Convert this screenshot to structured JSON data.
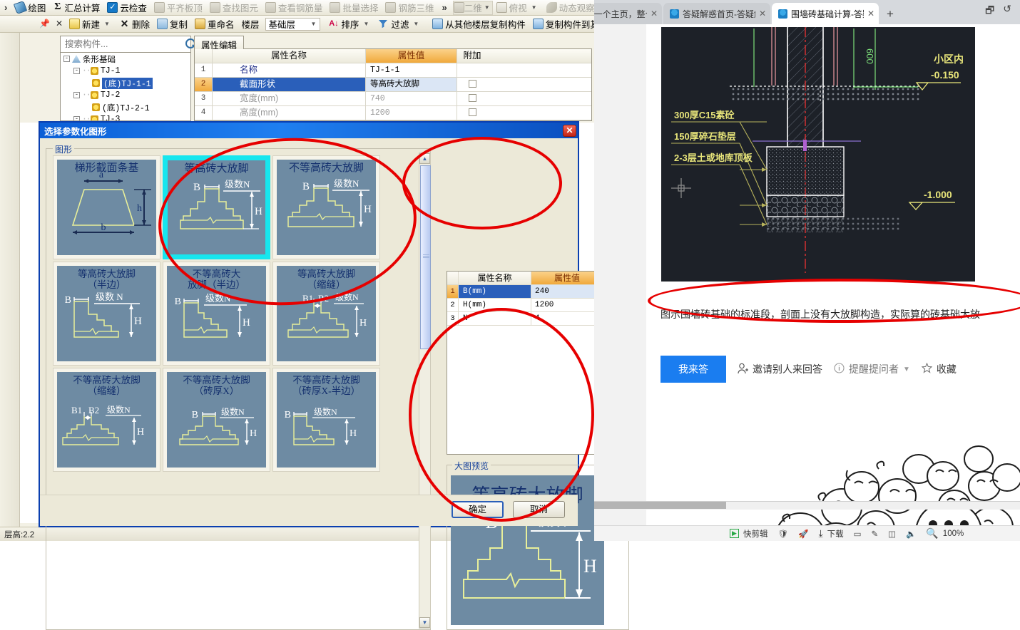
{
  "app": {
    "toolbar1": [
      {
        "label": "绘图",
        "icon": "pen-icon",
        "dim": false
      },
      {
        "label": "汇总计算",
        "icon": "sigma-icon",
        "dim": false
      },
      {
        "label": "云检查",
        "icon": "cloud-check-icon",
        "dim": false
      },
      {
        "label": "平齐板顶",
        "icon": "align-slab-icon",
        "dim": true
      },
      {
        "label": "查找图元",
        "icon": "binoculars-icon",
        "dim": true
      },
      {
        "label": "查看钢筋量",
        "icon": "rebar-view-icon",
        "dim": true
      },
      {
        "label": "批量选择",
        "icon": "batch-select-icon",
        "dim": true
      },
      {
        "label": "钢筋三维",
        "icon": "rebar-3d-icon",
        "dim": true
      }
    ],
    "toolbar1_overflow": "»",
    "toolbar1_right": [
      {
        "label": "二维",
        "icon": "2d-icon",
        "caret": true
      },
      {
        "label": "俯视",
        "icon": "topview-icon",
        "caret": true
      },
      {
        "label": "动态观察",
        "icon": "orbit-icon",
        "caret": false
      }
    ],
    "toolbar1_right_overflow": "»",
    "toolbar2": [
      {
        "label": "新建",
        "icon": "new-icon",
        "caret": true
      },
      {
        "label": "删除",
        "icon": "delete-icon",
        "caret": false
      },
      {
        "label": "复制",
        "icon": "copy-icon",
        "caret": false
      },
      {
        "label": "重命名",
        "icon": "rename-icon",
        "caret": false
      }
    ],
    "floor_label": "楼层",
    "floor_value": "基础层",
    "toolbar2b": [
      {
        "label": "排序",
        "icon": "sort-icon",
        "caret": true
      },
      {
        "label": "过滤",
        "icon": "filter-icon",
        "caret": true
      },
      {
        "label": "从其他楼层复制构件",
        "icon": "copy-from-floor-icon",
        "caret": false
      },
      {
        "label": "复制构件到其他楼层",
        "icon": "copy-to-floor-icon",
        "caret": false
      }
    ],
    "toolbar2_overflow": "»",
    "pin_icon": "pin-icon",
    "close_icon": "close-icon",
    "tree": {
      "search_placeholder": "搜索构件...",
      "search_value": "",
      "search_icon": "search-icon",
      "nodes": [
        {
          "depth": 0,
          "expander": "-",
          "icon": "strip-foundation-icon",
          "label": "条形基础",
          "selected": false
        },
        {
          "depth": 1,
          "expander": "-",
          "icon": "gear-icon",
          "label": "TJ-1",
          "selected": false
        },
        {
          "depth": 2,
          "expander": "",
          "icon": "gear-icon",
          "label": "(底)TJ-1-1",
          "selected": true
        },
        {
          "depth": 1,
          "expander": "-",
          "icon": "gear-icon",
          "label": "TJ-2",
          "selected": false
        },
        {
          "depth": 2,
          "expander": "",
          "icon": "gear-icon",
          "label": "(底)TJ-2-1",
          "selected": false
        },
        {
          "depth": 1,
          "expander": "-",
          "icon": "gear-icon",
          "label": "TJ-3",
          "selected": false
        }
      ]
    },
    "property_editor": {
      "tab_label": "属性编辑",
      "columns": [
        "",
        "属性名称",
        "属性值",
        "附加"
      ],
      "rows": [
        {
          "idx": "1",
          "name": "名称",
          "value": "TJ-1-1",
          "extra": false,
          "selected": false,
          "grey": false
        },
        {
          "idx": "2",
          "name": "截面形状",
          "value": "等高砖大放脚",
          "extra": true,
          "selected": true,
          "grey": false
        },
        {
          "idx": "3",
          "name": "宽度(mm)",
          "value": "740",
          "extra": true,
          "selected": false,
          "grey": true
        },
        {
          "idx": "4",
          "name": "高度(mm)",
          "value": "1200",
          "extra": true,
          "selected": false,
          "grey": true
        }
      ]
    },
    "status": "层高:2.2"
  },
  "dialog": {
    "title": "选择参数化图形",
    "close_icon": "close-icon",
    "shape_group_label": "图形",
    "preview_group_label": "大图预览",
    "shapes": [
      {
        "title": "梯形截面条基",
        "type": "trapezoid",
        "labels": [
          "a",
          "b",
          "h"
        ],
        "selected": false
      },
      {
        "title": "等高砖大放脚",
        "type": "equal-step",
        "labels": [
          "B",
          "级数N",
          "H"
        ],
        "selected": true
      },
      {
        "title": "不等高砖大放脚",
        "type": "unequal-step",
        "labels": [
          "B",
          "级数N",
          "H"
        ],
        "selected": false
      },
      {
        "title": "等高砖大放脚\n（半边）",
        "type": "equal-half",
        "labels": [
          "B",
          "级数 N",
          "H"
        ],
        "selected": false
      },
      {
        "title": "不等高砖大\n放脚（半边）",
        "type": "unequal-half",
        "labels": [
          "B",
          "级数N",
          "H"
        ],
        "selected": false
      },
      {
        "title": "等高砖大放脚\n（缩缝）",
        "type": "equal-joint",
        "labels": [
          "B1",
          "B2",
          "级数N",
          "H"
        ],
        "selected": false
      },
      {
        "title": "不等高砖大放脚\n（缩缝）",
        "type": "unequal-joint",
        "labels": [
          "B1",
          "B2",
          "级数N",
          "H"
        ],
        "selected": false
      },
      {
        "title": "不等高砖大放脚\n（砖厚X）",
        "type": "unequal-thick",
        "labels": [
          "B",
          "级数N",
          "H"
        ],
        "selected": false
      },
      {
        "title": "不等高砖大放脚\n（砖厚X-半边）",
        "type": "unequal-thick-half",
        "labels": [
          "B",
          "级数N",
          "H"
        ],
        "selected": false
      }
    ],
    "params": {
      "columns": [
        "",
        "属性名称",
        "属性值"
      ],
      "rows": [
        {
          "idx": "1",
          "name": "B(mm)",
          "value": "240",
          "selected": true
        },
        {
          "idx": "2",
          "name": "H(mm)",
          "value": "1200",
          "selected": false
        },
        {
          "idx": "3",
          "name": "N",
          "value": "4",
          "selected": false
        }
      ]
    },
    "preview": {
      "title": "等高砖大放脚",
      "labels": [
        "B",
        "级数N",
        "H"
      ]
    },
    "ok_label": "确定",
    "cancel_label": "取消",
    "scroll_up_icon": "chevron-up-icon",
    "scroll_down_icon": "chevron-down-icon"
  },
  "browser": {
    "tabs": [
      {
        "label": "导航_一个主页，整个",
        "active": false,
        "favicon": false,
        "close_icon": "close-icon"
      },
      {
        "label": "答疑解惑首页-答疑解惑-",
        "active": false,
        "favicon": true,
        "close_icon": "close-icon"
      },
      {
        "label": "围墙砖基础计算-答疑解惑",
        "active": true,
        "favicon": true,
        "close_icon": "close-icon"
      }
    ],
    "new_tab_icon": "new-tab-icon",
    "window_icons": [
      "restore-icon",
      "refresh-icon"
    ],
    "drawing": {
      "annotations": [
        {
          "text": "小区内"
        },
        {
          "text": "-0.150"
        },
        {
          "text": "-1.000"
        },
        {
          "text": "300厚C15素砼"
        },
        {
          "text": "150厚碎石垫层"
        },
        {
          "text": "2-3层土或地库顶板"
        },
        {
          "text": "600"
        }
      ]
    },
    "question_text": "图示围墙砖基础的标准段，剖面上没有大放脚构造，实际算的砖基础大放",
    "answer_button": "我来答",
    "actions": [
      {
        "label": "邀请别人来回答",
        "icon": "invite-user-icon",
        "caret": false
      },
      {
        "label": "提醒提问者",
        "icon": "info-icon",
        "caret": true
      },
      {
        "label": "收藏",
        "icon": "star-icon",
        "caret": false
      }
    ],
    "statusbar": [
      {
        "label": "快剪辑",
        "icon": "clip-icon"
      },
      {
        "label": "",
        "icon": "shield-icon"
      },
      {
        "label": "",
        "icon": "rocket-icon"
      },
      {
        "label": "下载",
        "icon": "download-icon"
      },
      {
        "label": "",
        "icon": "window-icon"
      },
      {
        "label": "",
        "icon": "pen-tool-icon"
      },
      {
        "label": "",
        "icon": "split-icon"
      },
      {
        "label": "",
        "icon": "volume-icon"
      },
      {
        "label": "100%",
        "icon": "zoom-icon"
      }
    ]
  },
  "annotations": {
    "accent_color": "#e60000",
    "count": 4
  }
}
